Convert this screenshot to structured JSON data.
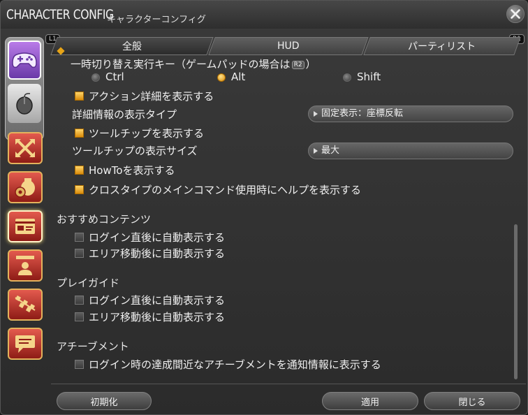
{
  "window": {
    "title": "CHARACTER CONFIG",
    "subtitle": "キャラクターコンフィグ"
  },
  "tabs": {
    "l_badge": "L1",
    "r_badge": "R1",
    "items": [
      {
        "label": "全般",
        "active": true
      },
      {
        "label": "HUD",
        "active": false
      },
      {
        "label": "パーティリスト",
        "active": false
      }
    ]
  },
  "toggle_key": {
    "label_pre": "一時切り替え実行キー（ゲームパッドの場合は",
    "badge": "R2",
    "label_post": "）",
    "options": [
      {
        "label": "Ctrl",
        "selected": false
      },
      {
        "label": "Alt",
        "selected": true
      },
      {
        "label": "Shift",
        "selected": false
      }
    ]
  },
  "settings": {
    "action_detail": {
      "label": "アクション詳細を表示する",
      "checked": true
    },
    "detail_type": {
      "label": "詳細情報の表示タイプ",
      "value": "固定表示：座標反転"
    },
    "tooltip": {
      "label": "ツールチップを表示する",
      "checked": true
    },
    "tooltip_size": {
      "label": "ツールチップの表示サイズ",
      "value": "最大"
    },
    "howto": {
      "label": "HowToを表示する",
      "checked": true
    },
    "cross_help": {
      "label": "クロスタイプのメインコマンド使用時にヘルプを表示する",
      "checked": true
    }
  },
  "sections": {
    "recommended": {
      "title": "おすすめコンテンツ",
      "items": [
        {
          "label": "ログイン直後に自動表示する",
          "checked": false
        },
        {
          "label": "エリア移動後に自動表示する",
          "checked": false
        }
      ]
    },
    "play_guide": {
      "title": "プレイガイド",
      "items": [
        {
          "label": "ログイン直後に自動表示する",
          "checked": false
        },
        {
          "label": "エリア移動後に自動表示する",
          "checked": false
        }
      ]
    },
    "achievement": {
      "title": "アチーブメント",
      "items": [
        {
          "label": "ログイン時の達成間近なアチーブメントを通知情報に表示する",
          "checked": false
        }
      ]
    }
  },
  "buttons": {
    "reset": "初期化",
    "apply": "適用",
    "close": "閉じる"
  },
  "colors": {
    "accent": "#e7a417",
    "category_red": "#c13a30",
    "gamepad_purple": "#8a4fc8"
  },
  "icons": {
    "close": "close-icon",
    "gamepad": "gamepad-icon",
    "mouse": "mouse-icon",
    "categories": [
      "cross-arrows-icon",
      "money-bag-gear-icon",
      "id-card-icon",
      "user-profile-icon",
      "checkered-flag-icon",
      "chat-bubble-icon"
    ]
  }
}
